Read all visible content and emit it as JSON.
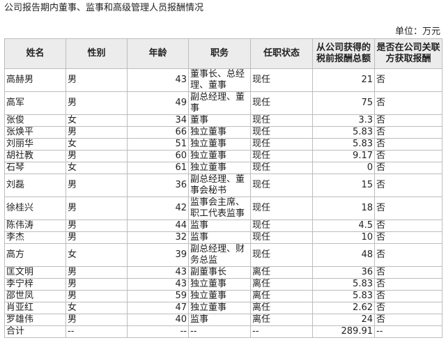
{
  "title": "公司报告期内董事、监事和高级管理人员报酬情况",
  "unit_label": "单位：万元",
  "columns": [
    "姓名",
    "性别",
    "年龄",
    "职务",
    "任职状态",
    "从公司获得的税前报酬总额",
    "是否在公司关联方获取报酬"
  ],
  "rows": [
    {
      "name": "高赫男",
      "gender": "男",
      "age": "43",
      "position": "董事长、总经理、董事",
      "status": "现任",
      "pay": "21",
      "related": "否"
    },
    {
      "name": "高军",
      "gender": "男",
      "age": "49",
      "position": "副总经理、董事",
      "status": "现任",
      "pay": "75",
      "related": "否"
    },
    {
      "name": "张俊",
      "gender": "女",
      "age": "34",
      "position": "董事",
      "status": "现任",
      "pay": "3.3",
      "related": "否"
    },
    {
      "name": "张焕平",
      "gender": "男",
      "age": "66",
      "position": "独立董事",
      "status": "现任",
      "pay": "5.83",
      "related": "否"
    },
    {
      "name": "刘丽华",
      "gender": "女",
      "age": "51",
      "position": "独立董事",
      "status": "现任",
      "pay": "5.83",
      "related": "否"
    },
    {
      "name": "胡社教",
      "gender": "男",
      "age": "60",
      "position": "独立董事",
      "status": "现任",
      "pay": "9.17",
      "related": "否"
    },
    {
      "name": "石琴",
      "gender": "女",
      "age": "61",
      "position": "独立董事",
      "status": "现任",
      "pay": "0",
      "related": "否"
    },
    {
      "name": "刘磊",
      "gender": "男",
      "age": "36",
      "position": "副总经理、董事会秘书",
      "status": "现任",
      "pay": "15",
      "related": "否"
    },
    {
      "name": "徐桂兴",
      "gender": "男",
      "age": "42",
      "position": "监事会主席、职工代表监事",
      "status": "现任",
      "pay": "18",
      "related": "否"
    },
    {
      "name": "陈伟涛",
      "gender": "男",
      "age": "44",
      "position": "监事",
      "status": "现任",
      "pay": "4.5",
      "related": "否"
    },
    {
      "name": "李杰",
      "gender": "男",
      "age": "32",
      "position": "监事",
      "status": "现任",
      "pay": "10",
      "related": "否"
    },
    {
      "name": "高方",
      "gender": "女",
      "age": "39",
      "position": "副总经理、财务总监",
      "status": "现任",
      "pay": "48",
      "related": "否"
    },
    {
      "name": "匡文明",
      "gender": "男",
      "age": "43",
      "position": "副董事长",
      "status": "离任",
      "pay": "36",
      "related": "否"
    },
    {
      "name": "李宁梓",
      "gender": "男",
      "age": "43",
      "position": "独立董事",
      "status": "离任",
      "pay": "5.83",
      "related": "否"
    },
    {
      "name": "邵世凤",
      "gender": "男",
      "age": "59",
      "position": "独立董事",
      "status": "离任",
      "pay": "5.83",
      "related": "否"
    },
    {
      "name": "肖亚红",
      "gender": "女",
      "age": "47",
      "position": "独立董事",
      "status": "离任",
      "pay": "2.62",
      "related": "否"
    },
    {
      "name": "罗雄伟",
      "gender": "男",
      "age": "40",
      "position": "监事",
      "status": "离任",
      "pay": "24",
      "related": "否"
    },
    {
      "name": "合计",
      "gender": "--",
      "age": "--",
      "position": "--",
      "status": "--",
      "pay": "289.91",
      "related": "--"
    }
  ],
  "tall_rows": [
    0,
    1,
    7,
    8,
    11
  ]
}
